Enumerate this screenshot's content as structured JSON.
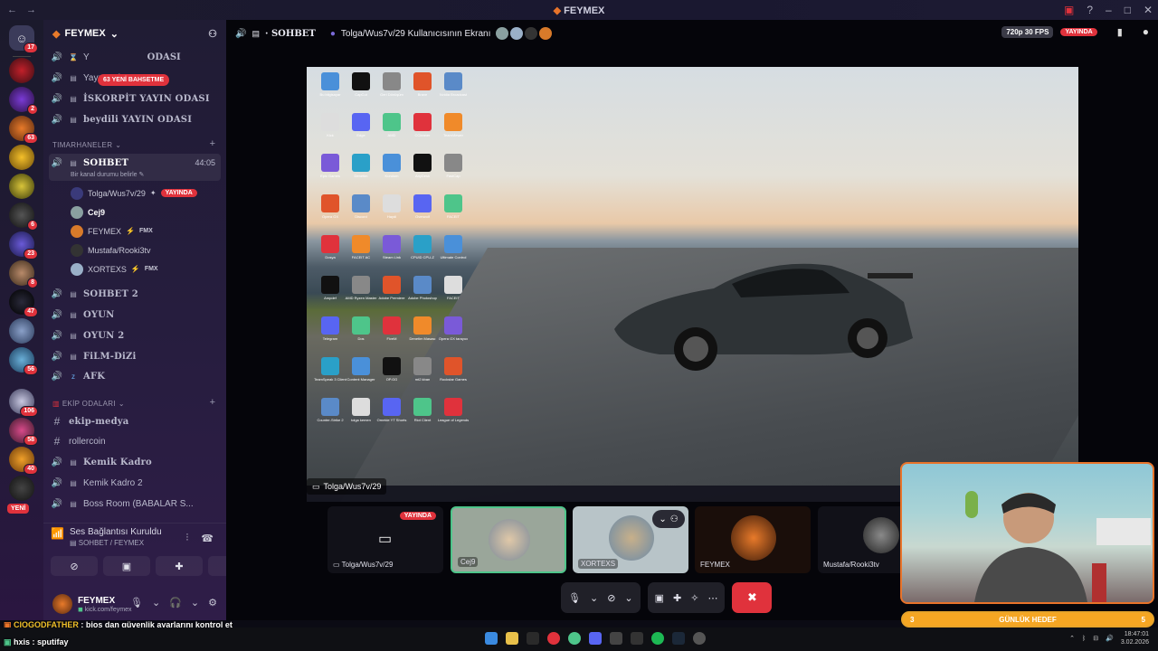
{
  "window": {
    "title": "FEYMEX"
  },
  "guilds": {
    "home_badge": "17",
    "badges": [
      "2",
      "63",
      "6",
      "23",
      "8",
      "47",
      "56",
      "106",
      "58",
      "40"
    ],
    "new_label": "YENİ"
  },
  "server": {
    "name": "FEYMEX",
    "mention_badge": "63 YENİ BAHSETME",
    "channels_top": [
      {
        "label": "YAYIN ODASI",
        "prefix": "Y"
      },
      {
        "label": "Yayın Odası"
      },
      {
        "label": "İSKORPİT YAYIN ODASI"
      },
      {
        "label": "beydili YAYIN ODASI"
      }
    ],
    "category1": "TIMARHANELER",
    "active_channel": {
      "label": "SOHBET",
      "timer": "44:05",
      "status": "Bir kanal durumu belirle"
    },
    "users": [
      {
        "name": "Tolga/Wus7v/29",
        "live": "YAYINDA"
      },
      {
        "name": "Cej9"
      },
      {
        "name": "FEYMEX",
        "tag": "FMX"
      },
      {
        "name": "Mustafa/Rooki3tv"
      },
      {
        "name": "XORTEXS",
        "tag": "FMX"
      }
    ],
    "channels_more": [
      "SOHBET 2",
      "OYUN",
      "OYUN 2",
      "FiLM-DiZi",
      "AFK"
    ],
    "category2": "EKİP ODALARI",
    "channels_ekip": [
      "ekip-medya",
      "rollercoin",
      "Kemik Kadro",
      "Kemik Kadro 2",
      "Boss Room (BABALAR S..."
    ]
  },
  "voice": {
    "status": "Ses Bağlantısı Kuruldu",
    "location": "SOHBET / FEYMEX"
  },
  "user_panel": {
    "name": "FEYMEX",
    "sub": "kick.com/feymex"
  },
  "stage": {
    "channel": "SOHBET",
    "title": "Tolga/Wus7v/29 Kullanıcısının Ekranı",
    "quality": "720p 30 FPS",
    "live": "YAYINDA",
    "screen_owner": "Tolga/Wus7v/29",
    "desktop_icons": [
      "Bu bilgisayar",
      "CapCut",
      "Geri Dönüşüm",
      "Brave",
      "Nvidia Broadcast",
      "Kick",
      "Edge",
      "AMD",
      "CCleaner",
      "TeamViewer",
      "Epic Games",
      "Denetim",
      "Kurulum",
      "AnyDesk",
      "FastCap",
      "Opera GX",
      "Discord",
      "Haydi",
      "Overwolf",
      "FACEIT",
      "Dosya",
      "FACEIT AC",
      "Steam Link",
      "CPUID CPU-Z",
      "Ultimate Control",
      "Ampdef",
      "AMD Ryzen Master",
      "Adobe Premiere",
      "Adobe Photoshop",
      "FACEIT",
      "Telegram",
      "Dos",
      "FiveM",
      "Denetim Masası",
      "Opera GX tarayıcı",
      "TeamSpeak 3 Client",
      "Content Manager",
      "OP.GG",
      "mt2 kban",
      "Rockstar Games",
      "Counter-Strike 2",
      "tolga kemen",
      "Ornekle YT Shorts",
      "Riot Client",
      "League of Legends"
    ],
    "tiles": [
      {
        "name": "Tolga/Wus7v/29",
        "live": "YAYINDA"
      },
      {
        "name": "Cej9"
      },
      {
        "name": "XORTEXS"
      },
      {
        "name": "FEYMEX"
      },
      {
        "name": "Mustafa/Rooki3tv"
      }
    ]
  },
  "overlay": {
    "goal_left": "3",
    "goal_label": "GÜNLÜK HEDEF",
    "goal_right": "5",
    "chat": [
      {
        "user": "CIOGODFATHER",
        "text": "bios dan güvenlik ayarlarını kontrol et"
      },
      {
        "user": "hxis",
        "text": "sputifay"
      }
    ]
  },
  "taskbar": {
    "time": "18:47:01",
    "date": "3.02.2026"
  },
  "colors": {
    "accent_red": "#e0323c",
    "goal_orange": "#f5a623",
    "select_green": "#4ec58a"
  }
}
